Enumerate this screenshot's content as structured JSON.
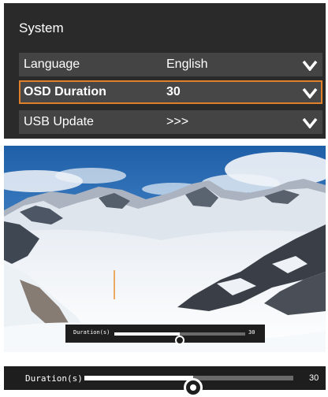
{
  "osd": {
    "title": "System",
    "rows": [
      {
        "label": "Language",
        "value": "English",
        "icon": "chevron-down-icon"
      },
      {
        "label": "OSD Duration",
        "value": "30",
        "icon": "chevron-down-icon",
        "selected": true
      },
      {
        "label": "USB Update",
        "value": ">>>",
        "icon": "chevron-down-icon"
      }
    ],
    "colors": {
      "background": "#2a2a2a",
      "row": "#444444",
      "highlight": "#e0802a",
      "text": "#ffffff"
    }
  },
  "preview": {
    "duration_bar": {
      "label": "Duration(s)",
      "value": "30",
      "level_percent": 50
    }
  },
  "zoom": {
    "duration_bar": {
      "label": "Duration(s)",
      "value": "30",
      "level_percent": 52
    }
  }
}
